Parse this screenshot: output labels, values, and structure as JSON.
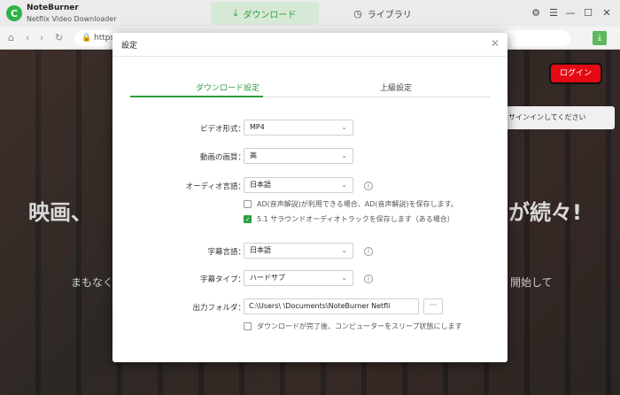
{
  "app": {
    "name": "NoteBurner",
    "subtitle": "Netflix Video Downloader",
    "logo_letter": "C"
  },
  "tabs": {
    "download": "ダウンロード",
    "library": "ライブラリ"
  },
  "browser": {
    "url": "https:"
  },
  "background": {
    "heading_left": "映画、",
    "heading_right": "が続々!",
    "sub_left": "まもなく",
    "sub_right": "開始して",
    "login": "ログイン",
    "tooltip": "にサインインしてください"
  },
  "modal": {
    "title": "設定",
    "tab_download": "ダウンロード設定",
    "tab_advanced": "上級設定",
    "video_format": {
      "label": "ビデオ形式：",
      "value": "MP4"
    },
    "quality": {
      "label": "動画の画質：",
      "value": "高"
    },
    "audio": {
      "label": "オーディオ言語：",
      "value": "日本語"
    },
    "ad_option": "AD(音声解説)が利用できる場合、AD(音声解説)を保存します。",
    "surround_option": "5.1 サラウンドオーディオトラックを保存します（ある場合）",
    "subtitle_lang": {
      "label": "字幕言語：",
      "value": "日本語"
    },
    "subtitle_type": {
      "label": "字幕タイプ：",
      "value": "ハードサブ"
    },
    "output": {
      "label": "出力フォルダ：",
      "path": "C:\\Users\\      \\Documents\\NoteBurner Netfli",
      "more": "···"
    },
    "sleep_option": "ダウンロードが完了後、コンピューターをスリープ状態にします"
  },
  "colors": {
    "accent": "#2e9e3e",
    "netflix_red": "#e50914"
  }
}
